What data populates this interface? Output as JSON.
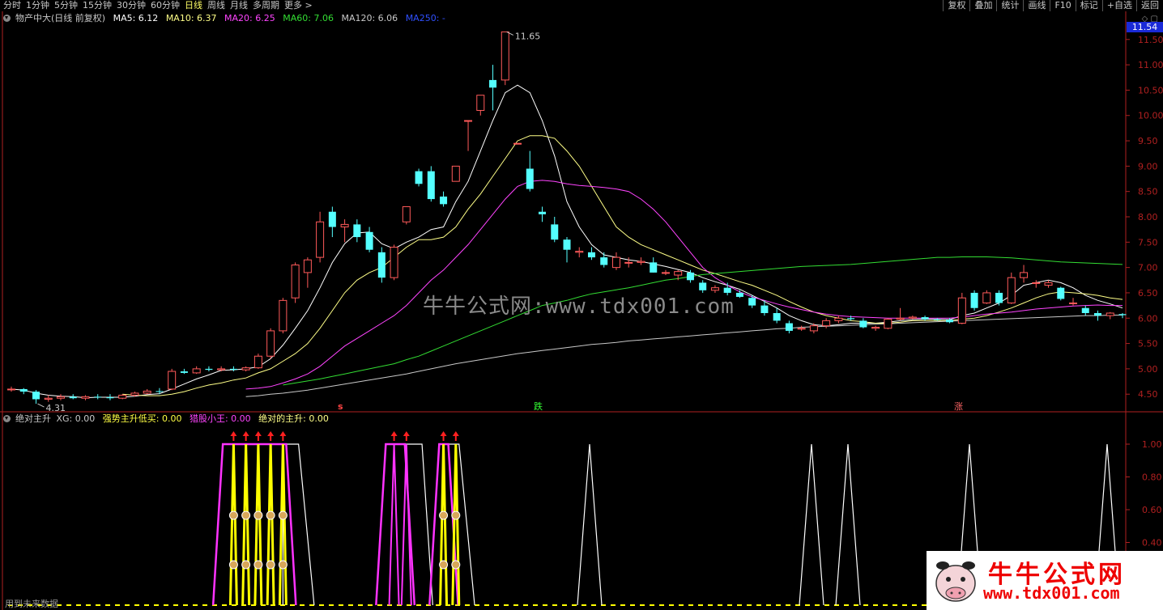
{
  "toolbar": {
    "periods": [
      "分时",
      "1分钟",
      "5分钟",
      "15分钟",
      "30分钟",
      "60分钟",
      "日线",
      "周线",
      "月线",
      "多周期",
      "更多 >"
    ],
    "active_index": 6,
    "right_buttons": [
      "复权",
      "叠加",
      "统计",
      "画线",
      "F10",
      "标记",
      "+自选",
      "返回"
    ]
  },
  "main_info": {
    "title": "物产中大(日线 前复权)",
    "ma5": "MA5: 6.12",
    "ma10": "MA10: 6.37",
    "ma20": "MA20: 6.25",
    "ma60": "MA60: 7.06",
    "ma120": "MA120: 6.06",
    "ma250": "MA250: -"
  },
  "colors": {
    "up": "#ff5a5a",
    "down": "#54ffff",
    "ma5": "#ffffff",
    "ma10": "#ffff88",
    "ma20": "#ff44ff",
    "ma60": "#33dd33",
    "ma120": "#c8c8c8",
    "ma250": "#3050ff",
    "axis": "#b02020",
    "yellow": "#ffff00",
    "magenta": "#ff33ff"
  },
  "current_price": "11.54",
  "price_axis": [
    "11.50",
    "11.00",
    "10.50",
    "10.00",
    "9.50",
    "9.00",
    "8.50",
    "8.00",
    "7.50",
    "7.00",
    "6.50",
    "6.00",
    "5.50",
    "5.00",
    "4.50"
  ],
  "high_label": "11.65",
  "low_label": "4.31",
  "signal_labels": {
    "s": "s",
    "die": "跌",
    "zhang": "涨"
  },
  "indicator_info": {
    "name": "绝对主升",
    "xg": "XG: 0.00",
    "qsds": "强势主升低买: 0.00",
    "lmxw": "猎股小王: 0.00",
    "jdzs": "绝对的主升: 0.00"
  },
  "indicator_axis": [
    "1.00",
    "0.80",
    "0.60",
    "0.40"
  ],
  "watermark": "牛牛公式网:www.tdx001.com",
  "logo": {
    "name": "牛牛公式网",
    "url": "www.tdx001.com"
  },
  "footer_note": "用到未来数据",
  "chart_data": {
    "type": "candlestick",
    "title": "物产中大(日线 前复权)",
    "ylim": [
      4.2,
      11.8
    ],
    "candles": [
      {
        "o": 4.6,
        "h": 4.65,
        "l": 4.55,
        "c": 4.6
      },
      {
        "o": 4.6,
        "h": 4.62,
        "l": 4.5,
        "c": 4.55
      },
      {
        "o": 4.55,
        "h": 4.58,
        "l": 4.31,
        "c": 4.4
      },
      {
        "o": 4.4,
        "h": 4.48,
        "l": 4.35,
        "c": 4.42
      },
      {
        "o": 4.42,
        "h": 4.5,
        "l": 4.38,
        "c": 4.45
      },
      {
        "o": 4.45,
        "h": 4.5,
        "l": 4.4,
        "c": 4.42
      },
      {
        "o": 4.42,
        "h": 4.48,
        "l": 4.38,
        "c": 4.45
      },
      {
        "o": 4.45,
        "h": 4.5,
        "l": 4.4,
        "c": 4.44
      },
      {
        "o": 4.44,
        "h": 4.5,
        "l": 4.38,
        "c": 4.42
      },
      {
        "o": 4.42,
        "h": 4.5,
        "l": 4.4,
        "c": 4.48
      },
      {
        "o": 4.48,
        "h": 4.55,
        "l": 4.45,
        "c": 4.52
      },
      {
        "o": 4.52,
        "h": 4.6,
        "l": 4.5,
        "c": 4.56
      },
      {
        "o": 4.56,
        "h": 4.62,
        "l": 4.5,
        "c": 4.55
      },
      {
        "o": 4.6,
        "h": 5.0,
        "l": 4.58,
        "c": 4.95
      },
      {
        "o": 4.95,
        "h": 5.0,
        "l": 4.9,
        "c": 4.92
      },
      {
        "o": 4.92,
        "h": 5.05,
        "l": 4.9,
        "c": 5.0
      },
      {
        "o": 5.0,
        "h": 5.05,
        "l": 4.95,
        "c": 4.98
      },
      {
        "o": 4.98,
        "h": 5.05,
        "l": 4.95,
        "c": 5.0
      },
      {
        "o": 5.0,
        "h": 5.05,
        "l": 4.95,
        "c": 4.98
      },
      {
        "o": 4.98,
        "h": 5.05,
        "l": 4.95,
        "c": 5.02
      },
      {
        "o": 5.02,
        "h": 5.3,
        "l": 5.0,
        "c": 5.25
      },
      {
        "o": 5.25,
        "h": 5.8,
        "l": 5.2,
        "c": 5.75
      },
      {
        "o": 5.75,
        "h": 6.4,
        "l": 5.7,
        "c": 6.35
      },
      {
        "o": 6.4,
        "h": 7.1,
        "l": 6.3,
        "c": 7.05
      },
      {
        "o": 6.9,
        "h": 7.2,
        "l": 6.6,
        "c": 7.15
      },
      {
        "o": 7.2,
        "h": 8.1,
        "l": 7.1,
        "c": 7.9
      },
      {
        "o": 8.1,
        "h": 8.2,
        "l": 7.6,
        "c": 7.8
      },
      {
        "o": 7.8,
        "h": 7.95,
        "l": 7.5,
        "c": 7.85
      },
      {
        "o": 7.85,
        "h": 7.95,
        "l": 7.5,
        "c": 7.6
      },
      {
        "o": 7.7,
        "h": 7.8,
        "l": 7.3,
        "c": 7.35
      },
      {
        "o": 7.3,
        "h": 7.4,
        "l": 6.7,
        "c": 6.8
      },
      {
        "o": 6.8,
        "h": 7.45,
        "l": 6.75,
        "c": 7.4
      },
      {
        "o": 7.9,
        "h": 8.2,
        "l": 7.85,
        "c": 8.2
      },
      {
        "o": 8.9,
        "h": 8.95,
        "l": 8.6,
        "c": 8.65
      },
      {
        "o": 8.9,
        "h": 9.0,
        "l": 8.3,
        "c": 8.35
      },
      {
        "o": 8.4,
        "h": 8.5,
        "l": 8.2,
        "c": 8.25
      },
      {
        "o": 8.7,
        "h": 9.0,
        "l": 8.7,
        "c": 9.0
      },
      {
        "o": 9.9,
        "h": 9.9,
        "l": 9.3,
        "c": 9.9
      },
      {
        "o": 10.1,
        "h": 10.4,
        "l": 10.0,
        "c": 10.4
      },
      {
        "o": 10.7,
        "h": 11.0,
        "l": 10.1,
        "c": 10.55
      },
      {
        "o": 10.7,
        "h": 11.65,
        "l": 10.6,
        "c": 11.65
      },
      {
        "o": 9.45,
        "h": 9.45,
        "l": 9.45,
        "c": 9.45
      },
      {
        "o": 8.95,
        "h": 9.3,
        "l": 8.5,
        "c": 8.55
      },
      {
        "o": 8.1,
        "h": 8.2,
        "l": 7.9,
        "c": 8.05
      },
      {
        "o": 7.85,
        "h": 8.0,
        "l": 7.5,
        "c": 7.55
      },
      {
        "o": 7.55,
        "h": 7.6,
        "l": 7.1,
        "c": 7.35
      },
      {
        "o": 7.3,
        "h": 7.4,
        "l": 7.2,
        "c": 7.32
      },
      {
        "o": 7.3,
        "h": 7.4,
        "l": 7.15,
        "c": 7.2
      },
      {
        "o": 7.2,
        "h": 7.3,
        "l": 7.0,
        "c": 7.05
      },
      {
        "o": 7.0,
        "h": 7.3,
        "l": 6.95,
        "c": 7.2
      },
      {
        "o": 7.1,
        "h": 7.2,
        "l": 7.0,
        "c": 7.1
      },
      {
        "o": 7.1,
        "h": 7.2,
        "l": 7.05,
        "c": 7.12
      },
      {
        "o": 7.1,
        "h": 7.2,
        "l": 6.9,
        "c": 6.9
      },
      {
        "o": 6.9,
        "h": 6.95,
        "l": 6.85,
        "c": 6.9
      },
      {
        "o": 6.85,
        "h": 6.95,
        "l": 6.75,
        "c": 6.92
      },
      {
        "o": 6.9,
        "h": 6.95,
        "l": 6.7,
        "c": 6.75
      },
      {
        "o": 6.7,
        "h": 6.75,
        "l": 6.5,
        "c": 6.55
      },
      {
        "o": 6.55,
        "h": 6.65,
        "l": 6.5,
        "c": 6.6
      },
      {
        "o": 6.6,
        "h": 6.7,
        "l": 6.45,
        "c": 6.5
      },
      {
        "o": 6.5,
        "h": 6.55,
        "l": 6.4,
        "c": 6.42
      },
      {
        "o": 6.4,
        "h": 6.45,
        "l": 6.2,
        "c": 6.25
      },
      {
        "o": 6.25,
        "h": 6.35,
        "l": 6.05,
        "c": 6.1
      },
      {
        "o": 6.1,
        "h": 6.2,
        "l": 5.9,
        "c": 5.95
      },
      {
        "o": 5.9,
        "h": 5.95,
        "l": 5.7,
        "c": 5.75
      },
      {
        "o": 5.8,
        "h": 5.85,
        "l": 5.75,
        "c": 5.8
      },
      {
        "o": 5.75,
        "h": 5.9,
        "l": 5.7,
        "c": 5.85
      },
      {
        "o": 5.85,
        "h": 6.0,
        "l": 5.8,
        "c": 5.95
      },
      {
        "o": 5.95,
        "h": 6.05,
        "l": 5.9,
        "c": 6.0
      },
      {
        "o": 6.0,
        "h": 6.05,
        "l": 5.95,
        "c": 5.98
      },
      {
        "o": 5.95,
        "h": 6.0,
        "l": 5.8,
        "c": 5.82
      },
      {
        "o": 5.8,
        "h": 5.85,
        "l": 5.75,
        "c": 5.82
      },
      {
        "o": 5.8,
        "h": 6.0,
        "l": 5.78,
        "c": 5.98
      },
      {
        "o": 5.98,
        "h": 6.2,
        "l": 5.95,
        "c": 6.0
      },
      {
        "o": 6.0,
        "h": 6.05,
        "l": 5.98,
        "c": 6.02
      },
      {
        "o": 6.02,
        "h": 6.05,
        "l": 5.95,
        "c": 5.98
      },
      {
        "o": 5.98,
        "h": 6.0,
        "l": 5.95,
        "c": 5.97
      },
      {
        "o": 5.97,
        "h": 6.0,
        "l": 5.9,
        "c": 5.92
      },
      {
        "o": 5.9,
        "h": 6.5,
        "l": 5.88,
        "c": 6.4
      },
      {
        "o": 6.5,
        "h": 6.55,
        "l": 6.15,
        "c": 6.2
      },
      {
        "o": 6.3,
        "h": 6.55,
        "l": 6.28,
        "c": 6.5
      },
      {
        "o": 6.5,
        "h": 6.55,
        "l": 6.25,
        "c": 6.3
      },
      {
        "o": 6.3,
        "h": 6.9,
        "l": 6.28,
        "c": 6.8
      },
      {
        "o": 6.8,
        "h": 7.05,
        "l": 6.7,
        "c": 6.9
      },
      {
        "o": 6.7,
        "h": 6.75,
        "l": 6.6,
        "c": 6.7
      },
      {
        "o": 6.65,
        "h": 6.75,
        "l": 6.6,
        "c": 6.7
      },
      {
        "o": 6.6,
        "h": 6.62,
        "l": 6.35,
        "c": 6.38
      },
      {
        "o": 6.3,
        "h": 6.4,
        "l": 6.25,
        "c": 6.3
      },
      {
        "o": 6.2,
        "h": 6.25,
        "l": 6.05,
        "c": 6.1
      },
      {
        "o": 6.1,
        "h": 6.15,
        "l": 5.95,
        "c": 6.05
      },
      {
        "o": 6.05,
        "h": 6.12,
        "l": 5.98,
        "c": 6.1
      },
      {
        "o": 6.08,
        "h": 6.1,
        "l": 6.0,
        "c": 6.06
      }
    ],
    "ma_lines": {
      "ma5": [
        4.6,
        4.58,
        4.52,
        4.48,
        4.46,
        4.45,
        4.43,
        4.44,
        4.44,
        4.44,
        4.46,
        4.49,
        4.51,
        4.6,
        4.7,
        4.8,
        4.88,
        4.97,
        4.98,
        5.0,
        5.04,
        5.2,
        5.47,
        5.8,
        6.15,
        6.6,
        7.1,
        7.47,
        7.68,
        7.7,
        7.47,
        7.37,
        7.5,
        7.6,
        7.75,
        7.8,
        8.3,
        8.7,
        9.3,
        9.9,
        10.45,
        10.6,
        10.45,
        9.9,
        9.2,
        8.3,
        7.8,
        7.45,
        7.25,
        7.2,
        7.15,
        7.12,
        7.07,
        7.02,
        6.96,
        6.9,
        6.8,
        6.72,
        6.65,
        6.57,
        6.45,
        6.33,
        6.2,
        6.05,
        5.95,
        5.87,
        5.85,
        5.87,
        5.9,
        5.9,
        5.9,
        5.92,
        5.95,
        5.97,
        5.98,
        5.98,
        5.97,
        6.05,
        6.1,
        6.2,
        6.3,
        6.45,
        6.65,
        6.7,
        6.75,
        6.7,
        6.6,
        6.45,
        6.35,
        6.28,
        6.2
      ],
      "ma10": [
        null,
        null,
        null,
        null,
        null,
        null,
        null,
        null,
        null,
        4.5,
        4.48,
        4.47,
        4.47,
        4.5,
        4.55,
        4.62,
        4.68,
        4.72,
        4.78,
        4.82,
        4.92,
        5.0,
        5.15,
        5.3,
        5.5,
        5.8,
        6.15,
        6.5,
        6.75,
        6.9,
        7.0,
        7.2,
        7.4,
        7.55,
        7.55,
        7.6,
        7.8,
        8.15,
        8.45,
        8.8,
        9.15,
        9.5,
        9.6,
        9.6,
        9.55,
        9.3,
        9.0,
        8.6,
        8.2,
        7.8,
        7.6,
        7.45,
        7.35,
        7.25,
        7.15,
        7.05,
        6.95,
        6.88,
        6.8,
        6.72,
        6.65,
        6.55,
        6.45,
        6.33,
        6.22,
        6.12,
        6.05,
        6.0,
        5.95,
        5.93,
        5.9,
        5.9,
        5.92,
        5.95,
        5.95,
        5.95,
        5.95,
        5.98,
        6.0,
        6.05,
        6.12,
        6.2,
        6.3,
        6.4,
        6.48,
        6.52,
        6.5,
        6.48,
        6.45,
        6.4,
        6.37
      ],
      "ma20": [
        null,
        null,
        null,
        null,
        null,
        null,
        null,
        null,
        null,
        null,
        null,
        null,
        null,
        null,
        null,
        null,
        null,
        null,
        null,
        4.6,
        4.62,
        4.65,
        4.72,
        4.8,
        4.9,
        5.05,
        5.25,
        5.45,
        5.6,
        5.75,
        5.9,
        6.05,
        6.25,
        6.5,
        6.75,
        6.95,
        7.2,
        7.45,
        7.75,
        8.05,
        8.35,
        8.6,
        8.7,
        8.72,
        8.7,
        8.65,
        8.62,
        8.6,
        8.58,
        8.55,
        8.5,
        8.35,
        8.15,
        7.9,
        7.6,
        7.3,
        7.0,
        6.8,
        6.65,
        6.52,
        6.42,
        6.35,
        6.28,
        6.22,
        6.17,
        6.12,
        6.08,
        6.05,
        6.03,
        6.02,
        6.01,
        6.0,
        6.0,
        6.0,
        6.0,
        6.0,
        6.0,
        6.02,
        6.05,
        6.08,
        6.1,
        6.12,
        6.15,
        6.18,
        6.2,
        6.22,
        6.24,
        6.25,
        6.26,
        6.25,
        6.25
      ],
      "ma60": [
        null,
        null,
        null,
        null,
        null,
        null,
        null,
        null,
        null,
        null,
        null,
        null,
        null,
        null,
        null,
        null,
        null,
        null,
        null,
        null,
        null,
        null,
        4.68,
        4.72,
        4.76,
        4.8,
        4.85,
        4.9,
        4.95,
        5.0,
        5.05,
        5.1,
        5.18,
        5.25,
        5.35,
        5.45,
        5.55,
        5.65,
        5.75,
        5.85,
        5.95,
        6.05,
        6.15,
        6.25,
        6.3,
        6.35,
        6.42,
        6.48,
        6.52,
        6.56,
        6.6,
        6.65,
        6.7,
        6.75,
        6.78,
        6.82,
        6.86,
        6.88,
        6.9,
        6.92,
        6.94,
        6.96,
        6.98,
        7.0,
        7.02,
        7.03,
        7.04,
        7.05,
        7.06,
        7.08,
        7.1,
        7.12,
        7.14,
        7.16,
        7.18,
        7.2,
        7.2,
        7.21,
        7.21,
        7.21,
        7.2,
        7.19,
        7.17,
        7.15,
        7.13,
        7.11,
        7.1,
        7.09,
        7.08,
        7.07,
        7.06
      ],
      "ma120": [
        null,
        null,
        null,
        null,
        null,
        null,
        null,
        null,
        null,
        null,
        null,
        null,
        null,
        null,
        null,
        null,
        null,
        null,
        null,
        4.45,
        4.47,
        4.5,
        4.52,
        4.55,
        4.58,
        4.62,
        4.66,
        4.7,
        4.74,
        4.78,
        4.82,
        4.86,
        4.9,
        4.95,
        5.0,
        5.05,
        5.1,
        5.14,
        5.18,
        5.22,
        5.26,
        5.3,
        5.33,
        5.36,
        5.39,
        5.42,
        5.45,
        5.48,
        5.5,
        5.52,
        5.55,
        5.57,
        5.59,
        5.61,
        5.63,
        5.65,
        5.67,
        5.69,
        5.71,
        5.73,
        5.75,
        5.77,
        5.79,
        5.8,
        5.82,
        5.83,
        5.84,
        5.85,
        5.86,
        5.87,
        5.88,
        5.89,
        5.9,
        5.91,
        5.92,
        5.93,
        5.94,
        5.95,
        5.96,
        5.97,
        5.98,
        5.99,
        6.0,
        6.01,
        6.02,
        6.03,
        6.04,
        6.05,
        6.05,
        6.06,
        6.06
      ]
    },
    "indicator": {
      "ylim": [
        0.3,
        1.0
      ],
      "white_spikes_x": [
        0.5,
        0.688,
        0.725,
        0.758,
        0.758,
        0.86,
        0.973
      ],
      "arrows_index": [
        18,
        19,
        20,
        21,
        22,
        31,
        32,
        35,
        36
      ]
    }
  }
}
